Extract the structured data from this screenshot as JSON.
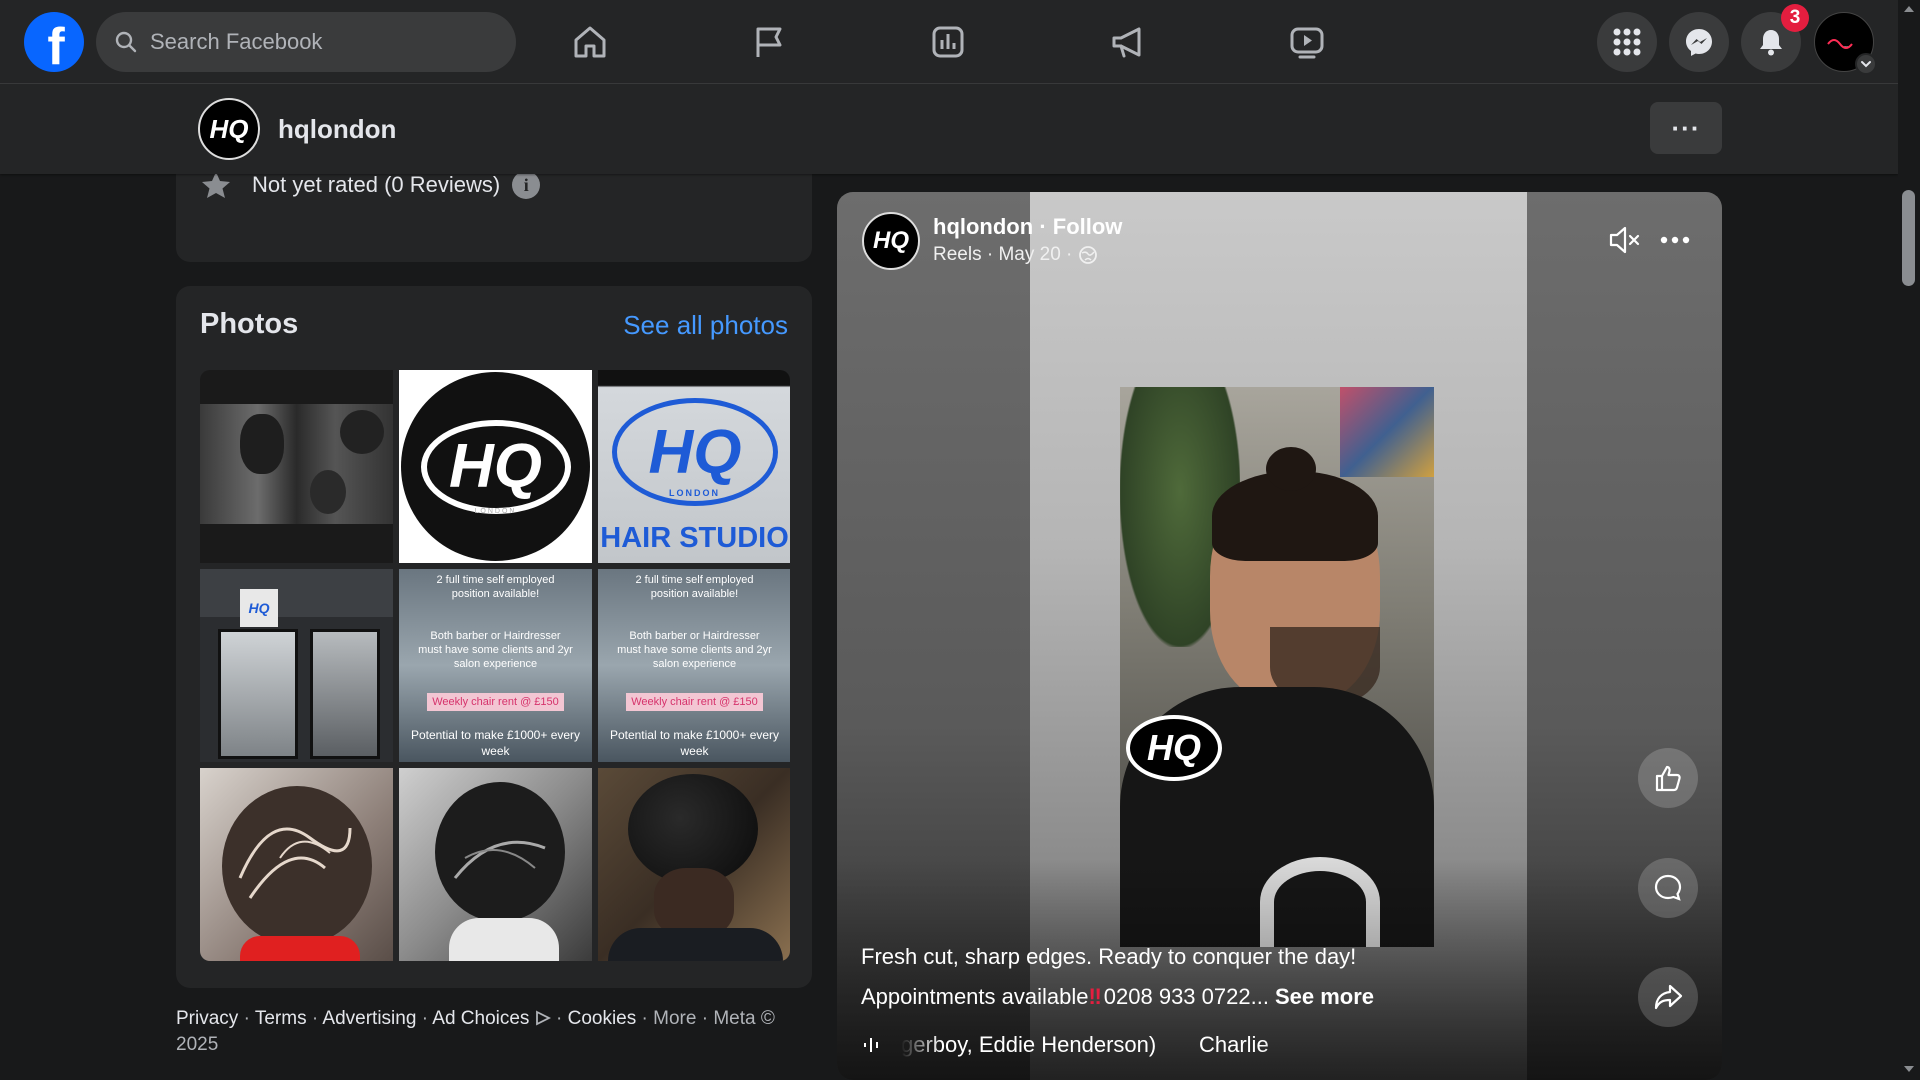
{
  "nav": {
    "logo_letter": "f",
    "search_placeholder": "Search Facebook",
    "center_icons": [
      "home-icon",
      "flag-icon",
      "chart-icon",
      "megaphone-icon",
      "video-icon"
    ],
    "notification_count": "3"
  },
  "page_header": {
    "name": "hqlondon",
    "logo_text": "HQ",
    "more_label": "···"
  },
  "rating": {
    "text": "Not yet rated (0 Reviews)",
    "info_glyph": "i"
  },
  "photos": {
    "title": "Photos",
    "see_all": "See all photos",
    "poster_line1": "2 full time self employed",
    "poster_line2": "position available!",
    "poster_line3": "Both barber or Hairdresser",
    "poster_line4": "must have some clients and 2yr",
    "poster_line5": "salon experience",
    "poster_rent": "Weekly chair rent @ £150",
    "poster_potential": "Potential to make £1000+ every week",
    "hair_studio": "HAIR STUDIO",
    "london": "LONDON"
  },
  "footer": {
    "privacy": "Privacy",
    "terms": "Terms",
    "advertising": "Advertising",
    "ad_choices": "Ad Choices",
    "cookies": "Cookies",
    "more": "More",
    "copyright": "Meta © 2025"
  },
  "reel": {
    "author": "hqlondon",
    "follow": "Follow",
    "meta": "Reels · May 20 ·",
    "caption_line1": "Fresh cut, sharp edges. Ready to conquer the day!",
    "caption_line2": "Appointments available",
    "caption_exclaim": "‼",
    "caption_phone": "0208 933 0722...",
    "see_more": "See more",
    "audio_text": "gerboy, Eddie Henderson)       Charlie"
  },
  "colors": {
    "bg": "#18191a",
    "surface": "#242526",
    "link": "#4599ff",
    "badge": "#e41e3f",
    "brand": "#0866ff"
  }
}
